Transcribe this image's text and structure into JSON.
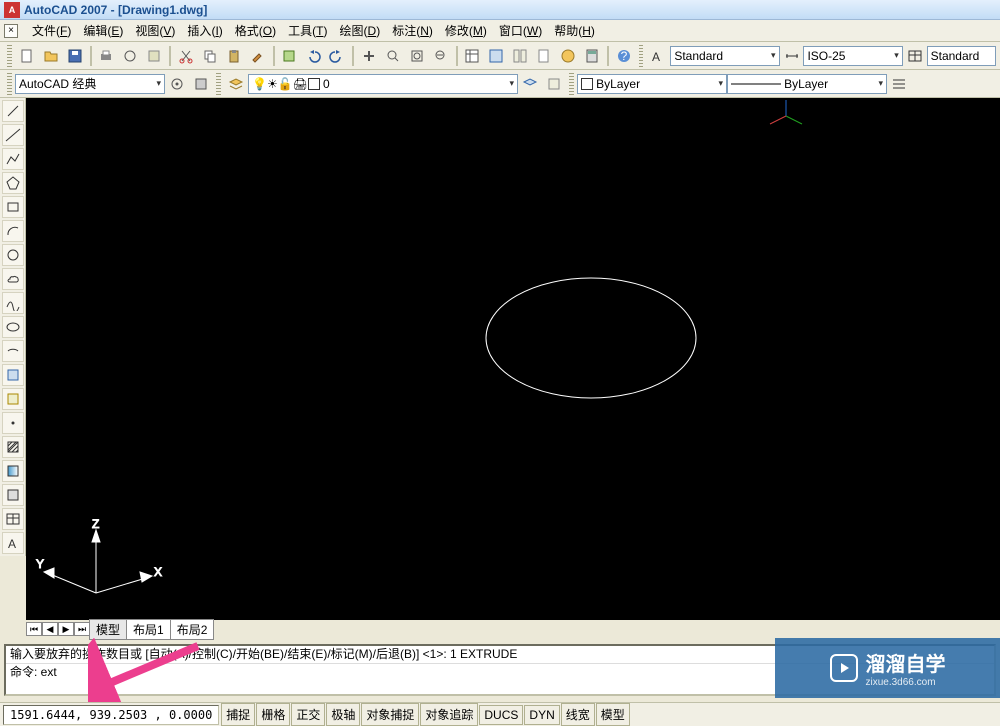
{
  "app": {
    "title": "AutoCAD 2007 - [Drawing1.dwg]",
    "logo_text": "A"
  },
  "menus": [
    {
      "label": "文件",
      "key": "F"
    },
    {
      "label": "编辑",
      "key": "E"
    },
    {
      "label": "视图",
      "key": "V"
    },
    {
      "label": "插入",
      "key": "I"
    },
    {
      "label": "格式",
      "key": "O"
    },
    {
      "label": "工具",
      "key": "T"
    },
    {
      "label": "绘图",
      "key": "D"
    },
    {
      "label": "标注",
      "key": "N"
    },
    {
      "label": "修改",
      "key": "M"
    },
    {
      "label": "窗口",
      "key": "W"
    },
    {
      "label": "帮助",
      "key": "H"
    }
  ],
  "workspace": "AutoCAD 经典",
  "layer_current": "0",
  "textstyle": "Standard",
  "dimstyle": "ISO-25",
  "tablestyle": "Standard",
  "prop_color": "ByLayer",
  "prop_linetype": "ByLayer",
  "tabs": {
    "model": "模型",
    "l1": "布局1",
    "l2": "布局2"
  },
  "ucs": {
    "x": "X",
    "y": "Y",
    "z": "Z"
  },
  "command": {
    "history": "输入要放弃的操作数目或 [自动(A)/控制(C)/开始(BE)/结束(E)/标记(M)/后退(B)] <1>:  1 EXTRUDE",
    "prompt": "命令: ext"
  },
  "status": {
    "coords": "1591.6444, 939.2503 , 0.0000",
    "toggles": [
      "捕捉",
      "栅格",
      "正交",
      "极轴",
      "对象捕捉",
      "对象追踪",
      "DUCS",
      "DYN",
      "线宽",
      "模型"
    ]
  },
  "watermark": {
    "title": "溜溜自学",
    "url": "zixue.3d66.com"
  }
}
